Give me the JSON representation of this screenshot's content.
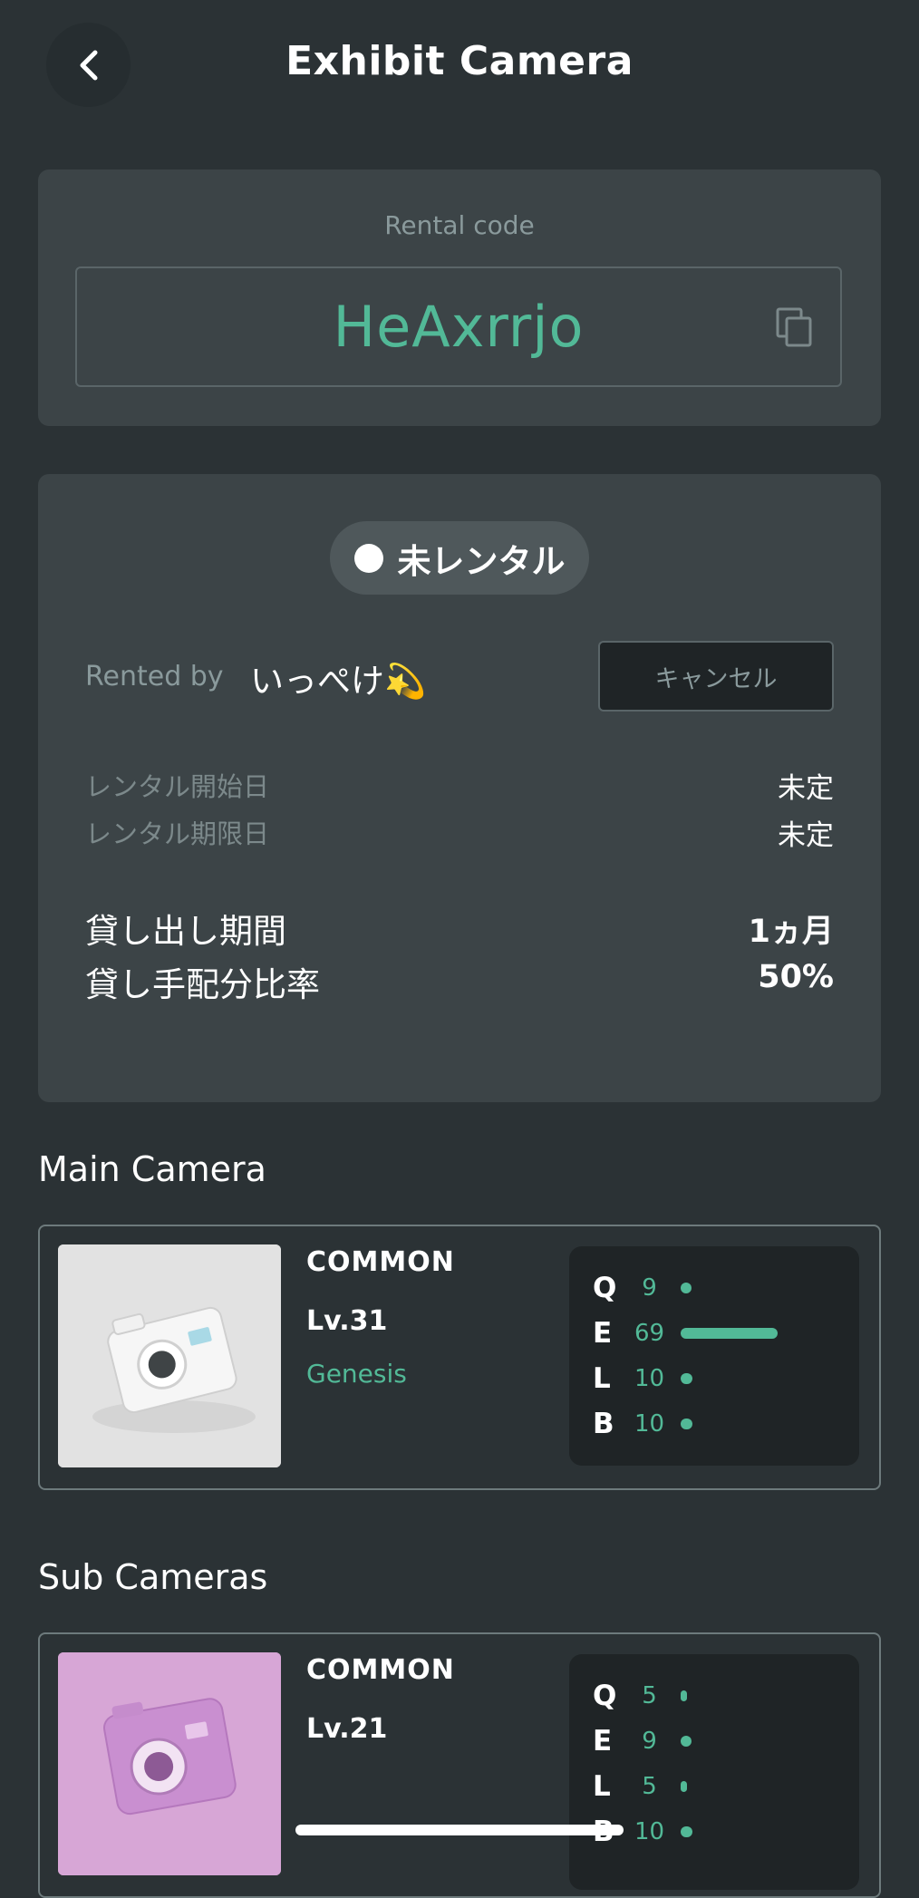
{
  "header": {
    "title": "Exhibit Camera"
  },
  "rental_code": {
    "label": "Rental code",
    "value": "HeAxrrjo"
  },
  "status": {
    "badge": "未レンタル",
    "rented_by_label": "Rented by",
    "rented_by_name": "いっぺけ💫",
    "cancel_label": "キャンセル",
    "start_label": "レンタル開始日",
    "start_value": "未定",
    "end_label": "レンタル期限日",
    "end_value": "未定",
    "period_label": "貸し出し期間",
    "period_value": "1ヵ月",
    "ratio_label": "貸し手配分比率",
    "ratio_value": "50%"
  },
  "main_camera": {
    "section_title": "Main Camera",
    "rarity": "COMMON",
    "level": "Lv.31",
    "series": "Genesis",
    "image_color": "#e3e3e3",
    "stats": [
      {
        "key": "Q",
        "value": 9
      },
      {
        "key": "E",
        "value": 69
      },
      {
        "key": "L",
        "value": 10
      },
      {
        "key": "B",
        "value": 10
      }
    ]
  },
  "sub_cameras": {
    "section_title": "Sub Cameras",
    "items": [
      {
        "rarity": "COMMON",
        "level": "Lv.21",
        "image_color": "#d9a8d8",
        "stats": [
          {
            "key": "Q",
            "value": 5
          },
          {
            "key": "E",
            "value": 9
          },
          {
            "key": "L",
            "value": 5
          },
          {
            "key": "B",
            "value": 10
          }
        ]
      }
    ]
  },
  "colors": {
    "accent": "#52b997",
    "background": "#2b3235",
    "card": "#3c4447"
  }
}
